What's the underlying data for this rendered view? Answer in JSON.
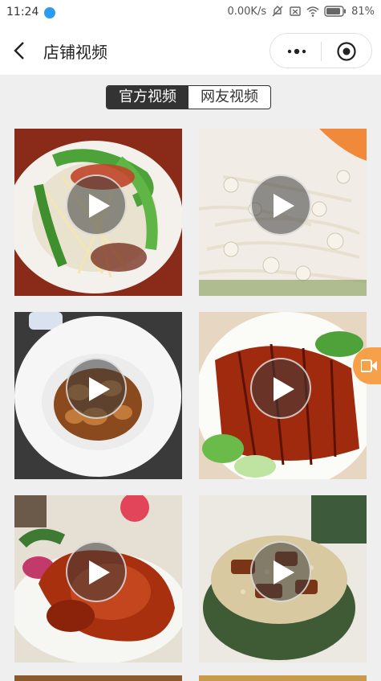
{
  "status_bar": {
    "time": "11:24",
    "network_speed": "0.00K/s",
    "battery": "81%",
    "icons": [
      "app-notification-icon",
      "mute-icon",
      "sim-off-icon",
      "wifi-icon",
      "battery-icon"
    ]
  },
  "nav": {
    "title": "店铺视频",
    "back_icon": "back-arrow-icon",
    "more_icon": "more-dots-icon",
    "close_icon": "target-close-icon"
  },
  "tabs": [
    {
      "label": "官方视频",
      "active": true
    },
    {
      "label": "网友视频",
      "active": false
    }
  ],
  "videos": [
    {
      "name": "video-thumb-green-pepper-enoki",
      "icon": "play-icon"
    },
    {
      "name": "video-thumb-enoki-mushroom",
      "icon": "play-icon"
    },
    {
      "name": "video-thumb-braised-fish-maw",
      "icon": "play-icon"
    },
    {
      "name": "video-thumb-glazed-pork",
      "icon": "play-icon"
    },
    {
      "name": "video-thumb-braised-pork-trotter",
      "icon": "play-icon"
    },
    {
      "name": "video-thumb-meat-rice-bowl",
      "icon": "play-icon"
    }
  ],
  "colors": {
    "accent": "#333333",
    "float_button": "#f6a14a",
    "background": "#efefef"
  }
}
